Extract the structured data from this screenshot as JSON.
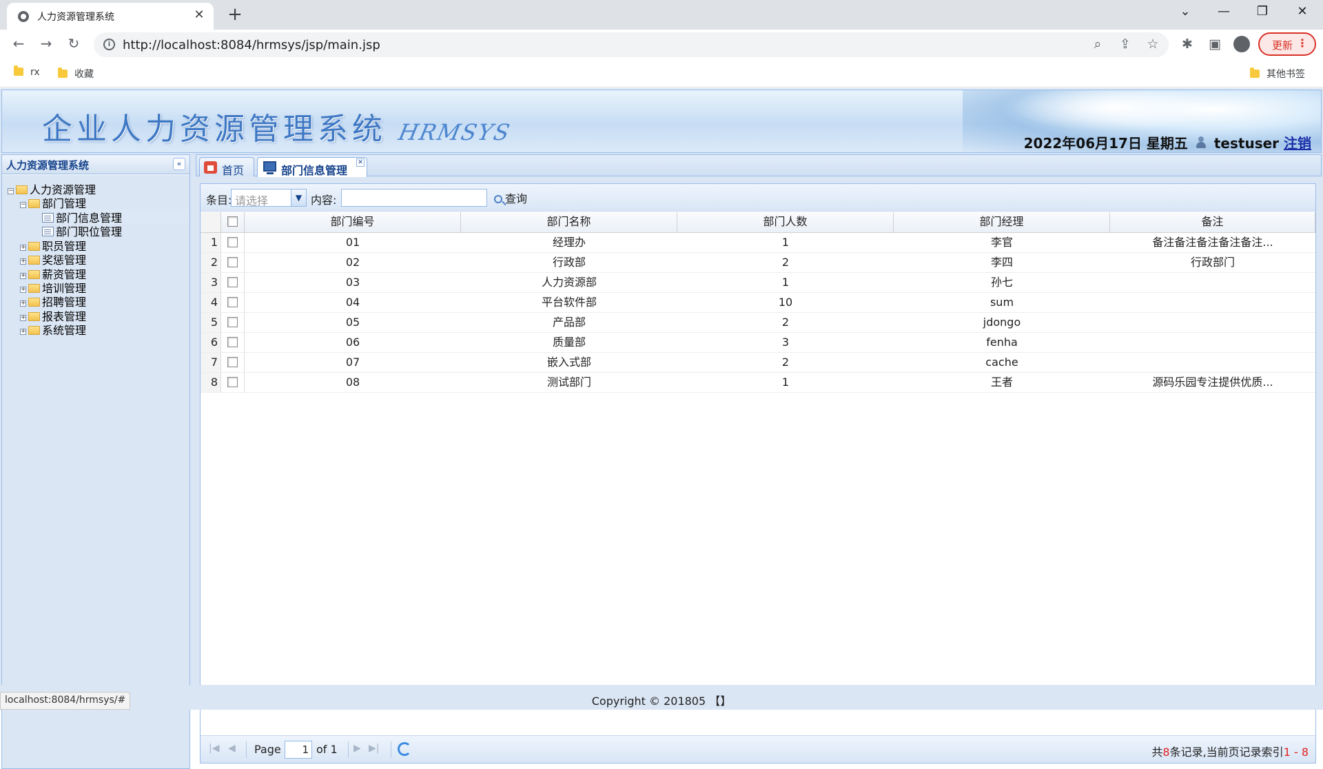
{
  "browser": {
    "tab_title": "人力资源管理系统",
    "url": "http://localhost:8084/hrmsys/jsp/main.jsp",
    "update_label": "更新",
    "bookmarks": [
      "rx",
      "收藏"
    ],
    "other_bookmarks": "其他书签",
    "status_url": "localhost:8084/hrmsys/#"
  },
  "header": {
    "logo_cn": "企业人力资源管理系统",
    "logo_en": "HRMSYS",
    "date": "2022年06月17日 星期五",
    "user": "testuser",
    "logout": "注销"
  },
  "sidebar": {
    "title": "人力资源管理系统",
    "root": "人力资源管理",
    "dept": "部门管理",
    "dept_children": [
      "部门信息管理",
      "部门职位管理"
    ],
    "others": [
      "职员管理",
      "奖惩管理",
      "薪资管理",
      "培训管理",
      "招聘管理",
      "报表管理",
      "系统管理"
    ]
  },
  "tabs": {
    "home": "首页",
    "dept_info": "部门信息管理"
  },
  "search": {
    "field_label": "条目:",
    "field_placeholder": "请选择",
    "content_label": "内容:",
    "content_value": "",
    "query_label": "查询"
  },
  "grid": {
    "columns": [
      "部门编号",
      "部门名称",
      "部门人数",
      "部门经理",
      "备注"
    ],
    "rows": [
      {
        "n": "1",
        "id": "01",
        "name": "经理办",
        "count": "1",
        "mgr": "李官",
        "note": "备注备注备注备注备注..."
      },
      {
        "n": "2",
        "id": "02",
        "name": "行政部",
        "count": "2",
        "mgr": "李四",
        "note": "行政部门"
      },
      {
        "n": "3",
        "id": "03",
        "name": "人力资源部",
        "count": "1",
        "mgr": "孙七",
        "note": ""
      },
      {
        "n": "4",
        "id": "04",
        "name": "平台软件部",
        "count": "10",
        "mgr": "sum",
        "note": ""
      },
      {
        "n": "5",
        "id": "05",
        "name": "产品部",
        "count": "2",
        "mgr": "jdongo",
        "note": ""
      },
      {
        "n": "6",
        "id": "06",
        "name": "质量部",
        "count": "3",
        "mgr": "fenha",
        "note": ""
      },
      {
        "n": "7",
        "id": "07",
        "name": "嵌入式部",
        "count": "2",
        "mgr": "cache",
        "note": ""
      },
      {
        "n": "8",
        "id": "08",
        "name": "测试部门",
        "count": "1",
        "mgr": "王者",
        "note": "源码乐园专注提供优质..."
      }
    ]
  },
  "pager": {
    "page_label": "Page",
    "page": "1",
    "of_label": "of 1",
    "info_prefix": "共",
    "total": "8",
    "info_mid": "条记录,当前页记录索引",
    "range": "1 - 8"
  },
  "footer": "Copyright © 201805 【】"
}
